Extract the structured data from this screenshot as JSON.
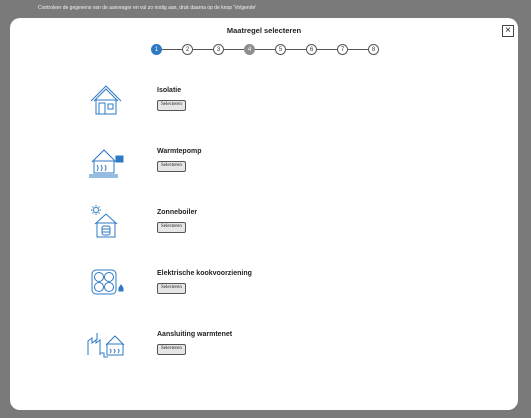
{
  "background": {
    "instruction": "Controleer de gegevens van de aanvrager en vul zo nodig aan, druk daarna op de knop 'Volgende'"
  },
  "modal": {
    "title": "Maatregel selecteren",
    "close_label": "×"
  },
  "stepper": {
    "current_step": 1,
    "steps": [
      {
        "label": "1",
        "state": "active"
      },
      {
        "label": "2",
        "state": "pending"
      },
      {
        "label": "3",
        "state": "pending"
      },
      {
        "label": "4",
        "state": "done"
      },
      {
        "label": "5",
        "state": "pending"
      },
      {
        "label": "6",
        "state": "pending"
      },
      {
        "label": "7",
        "state": "pending"
      },
      {
        "label": "8",
        "state": "pending"
      }
    ]
  },
  "options": [
    {
      "title": "Isolatie",
      "button": "Selecteren",
      "icon": "house-insulation-icon"
    },
    {
      "title": "Warmtepomp",
      "button": "Selecteren",
      "icon": "heat-pump-icon"
    },
    {
      "title": "Zonneboiler",
      "button": "Selecteren",
      "icon": "solar-boiler-icon"
    },
    {
      "title": "Elektrische kookvoorziening",
      "button": "Selecteren",
      "icon": "electric-cooktop-icon"
    },
    {
      "title": "Aansluiting warmtenet",
      "button": "Selecteren",
      "icon": "heat-network-icon"
    }
  ],
  "colors": {
    "icon": "#2f78c4",
    "active_step": "#2f78c4",
    "done_step": "#8e8e8e",
    "overlay": "#7a7a7a"
  }
}
